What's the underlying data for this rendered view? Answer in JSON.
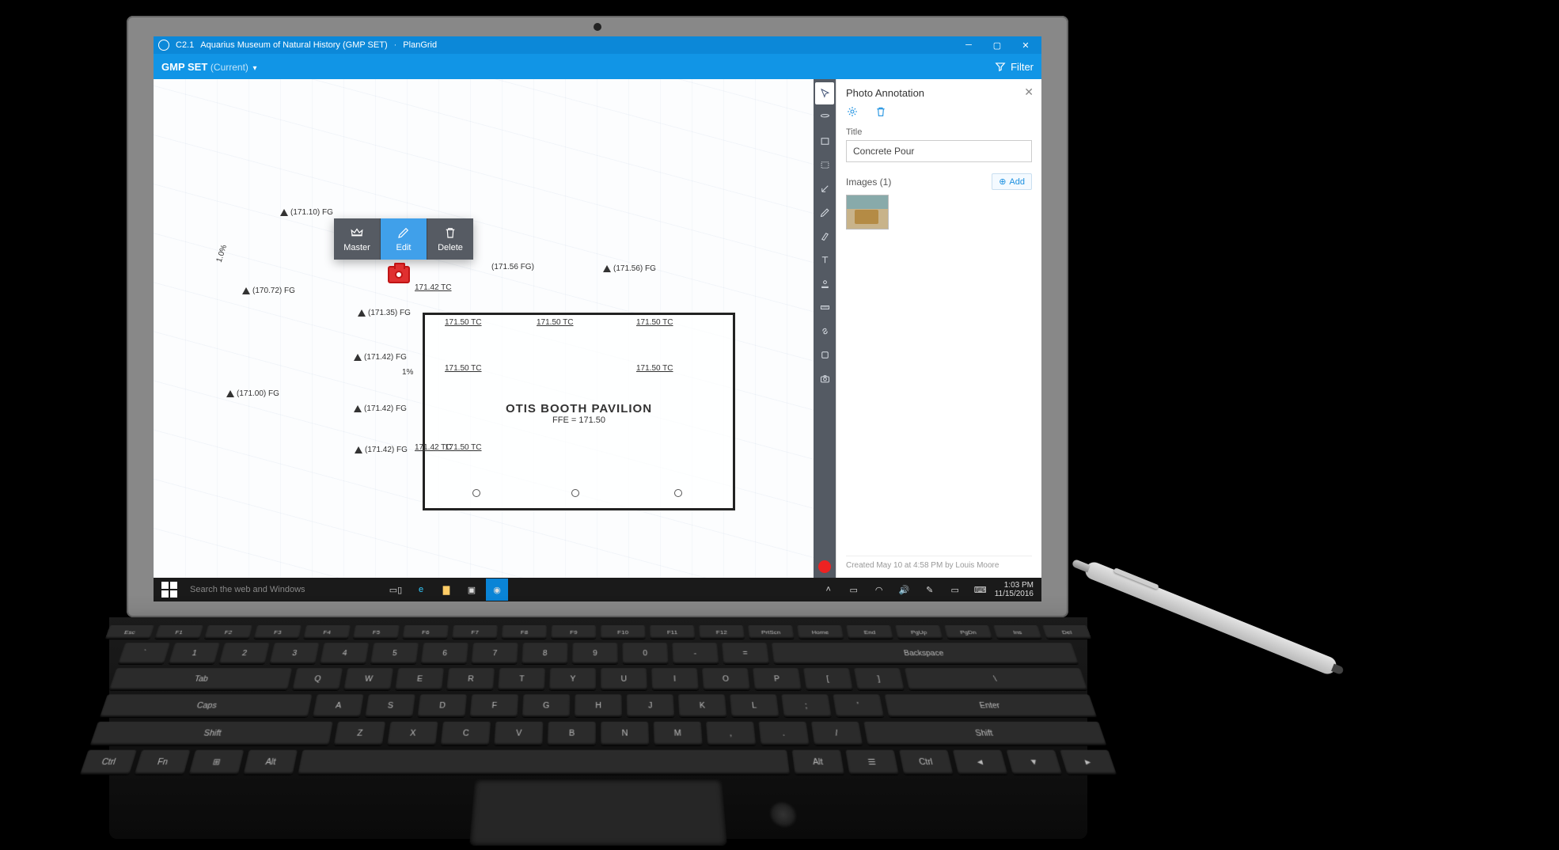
{
  "titlebar": {
    "sheet": "C2.1",
    "project": "Aquarius Museum of Natural History (GMP SET)",
    "app": "PlanGrid"
  },
  "toolbar": {
    "set_name": "GMP SET",
    "current_suffix": "(Current)",
    "filter_label": "Filter"
  },
  "context_menu": {
    "master": "Master",
    "edit": "Edit",
    "delete": "Delete"
  },
  "plan": {
    "pavilion_title": "OTIS  BOOTH  PAVILION",
    "pavilion_sub": "FFE  =  171.50",
    "labels": {
      "a": "(171.10)\nFG",
      "b": "(170.72)\nFG",
      "c": "(171.35)\nFG",
      "d": "(171.42)\nFG",
      "e": "(171.42)\nFG",
      "f": "(171.42)\nFG",
      "g": "(171.00)\nFG",
      "h": "(171.56 FG)",
      "i": "(171.56)\nFG",
      "j": "171.42\nTC",
      "j2": "171.42\nTC",
      "k": "171.50\nTC",
      "l": "171.50\nTC",
      "m": "171.50\nTC",
      "n": "171.50\nTC",
      "o": "171.50\nTC",
      "p": "171.50\nTC",
      "slope": "1.0%",
      "slope2": "1%"
    }
  },
  "panel": {
    "heading": "Photo Annotation",
    "title_label": "Title",
    "title_value": "Concrete Pour",
    "images_label": "Images (1)",
    "add_label": "Add",
    "footer": "Created May 10 at 4:58 PM by Louis Moore"
  },
  "taskbar": {
    "search_placeholder": "Search the web and Windows",
    "time": "1:03 PM",
    "date": "11/15/2016"
  },
  "keyboard": {
    "row_fn": [
      "Esc",
      "F1",
      "F2",
      "F3",
      "F4",
      "F5",
      "F6",
      "F7",
      "F8",
      "F9",
      "F10",
      "F11",
      "F12",
      "PrtScn",
      "Home",
      "End",
      "PgUp",
      "PgDn",
      "Ins",
      "Del"
    ],
    "row1": [
      "`",
      "1",
      "2",
      "3",
      "4",
      "5",
      "6",
      "7",
      "8",
      "9",
      "0",
      "-",
      "=",
      "Backspace"
    ],
    "row2": [
      "Tab",
      "Q",
      "W",
      "E",
      "R",
      "T",
      "Y",
      "U",
      "I",
      "O",
      "P",
      "[",
      "]",
      "\\"
    ],
    "row3": [
      "Caps",
      "A",
      "S",
      "D",
      "F",
      "G",
      "H",
      "J",
      "K",
      "L",
      ";",
      "'",
      "Enter"
    ],
    "row4": [
      "Shift",
      "Z",
      "X",
      "C",
      "V",
      "B",
      "N",
      "M",
      ",",
      ".",
      "/",
      "Shift"
    ],
    "row5": [
      "Ctrl",
      "Fn",
      "⊞",
      "Alt",
      "",
      "Alt",
      "☰",
      "Ctrl",
      "◄",
      "▼",
      "►"
    ]
  }
}
